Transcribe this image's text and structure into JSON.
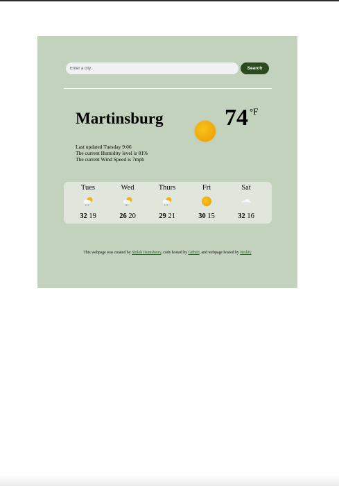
{
  "search": {
    "placeholder": "Enter a city..",
    "button_label": "Search"
  },
  "current": {
    "city": "Martinsburg",
    "temperature": "74",
    "unit": "°F",
    "icon": "sun-icon",
    "last_updated": "Last updated Tuesday 9:06",
    "humidity": "The current Humidity level is 81%",
    "wind": "The current Wind Speed is 7mph"
  },
  "forecast": [
    {
      "day": "Tues",
      "icon": "sun-cloud-rain-icon",
      "high": "32",
      "low": "19"
    },
    {
      "day": "Wed",
      "icon": "sun-cloud-rain-icon",
      "high": "26",
      "low": "20"
    },
    {
      "day": "Thurs",
      "icon": "sun-cloud-rain-icon",
      "high": "29",
      "low": "21"
    },
    {
      "day": "Fri",
      "icon": "sun-icon",
      "high": "30",
      "low": "15"
    },
    {
      "day": "Sat",
      "icon": "cloud-icon",
      "high": "32",
      "low": "16"
    }
  ],
  "footer": {
    "text1": "This webpage was created by ",
    "author": "Shiloh Huntsberry",
    "text2": ", code hosted by ",
    "code_host": "Github",
    "text3": ", and webpage hosted by ",
    "web_host": "Netlify"
  },
  "colors": {
    "panel": "#c2d2bc",
    "forecast_card": "#e0e6dc",
    "button": "#2d4a22",
    "link": "#2f5a2a"
  }
}
